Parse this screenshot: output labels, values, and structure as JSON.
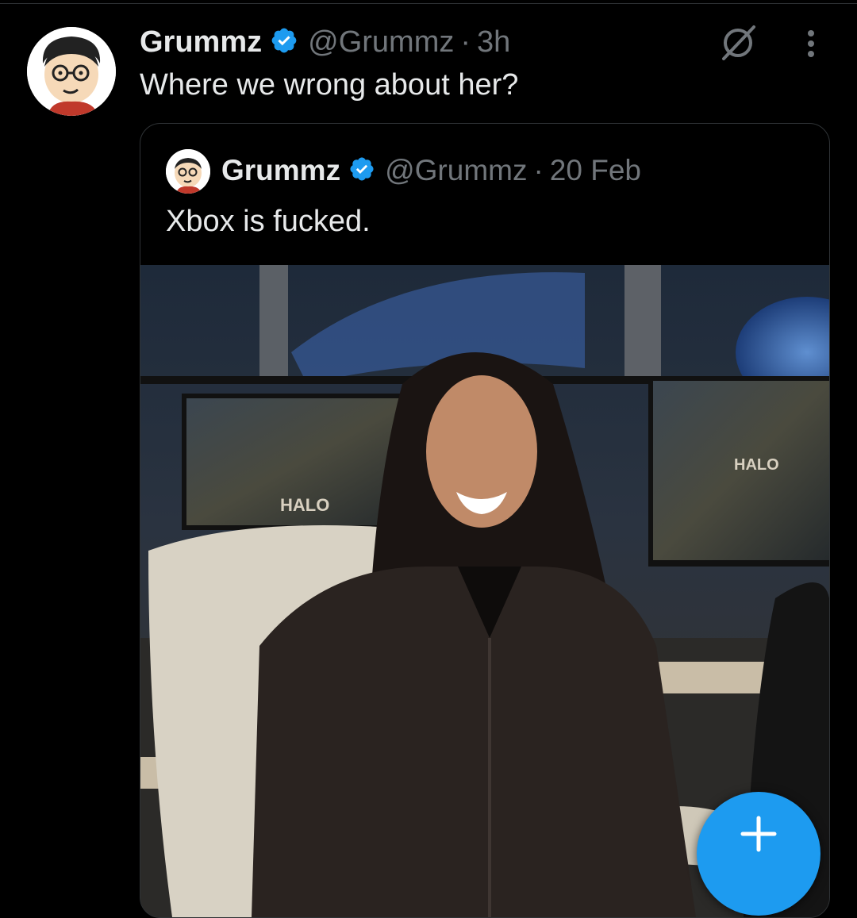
{
  "tweet": {
    "author_name": "Grummz",
    "handle": "@Grummz",
    "separator": "·",
    "time": "3h",
    "text": "Where we wrong about her?"
  },
  "quoted_tweet": {
    "author_name": "Grummz",
    "handle": "@Grummz",
    "separator": "·",
    "time": "20 Feb",
    "text": "Xbox is fucked.",
    "image_caption_text": [
      "HALO",
      "HALO"
    ]
  },
  "icons": {
    "verified": "verified-badge-icon",
    "grok": "grok-icon",
    "more": "more-icon",
    "compose": "plus-icon"
  },
  "colors": {
    "background": "#000000",
    "text": "#e7e9ea",
    "secondary": "#71767b",
    "accent": "#1d9bf0"
  }
}
